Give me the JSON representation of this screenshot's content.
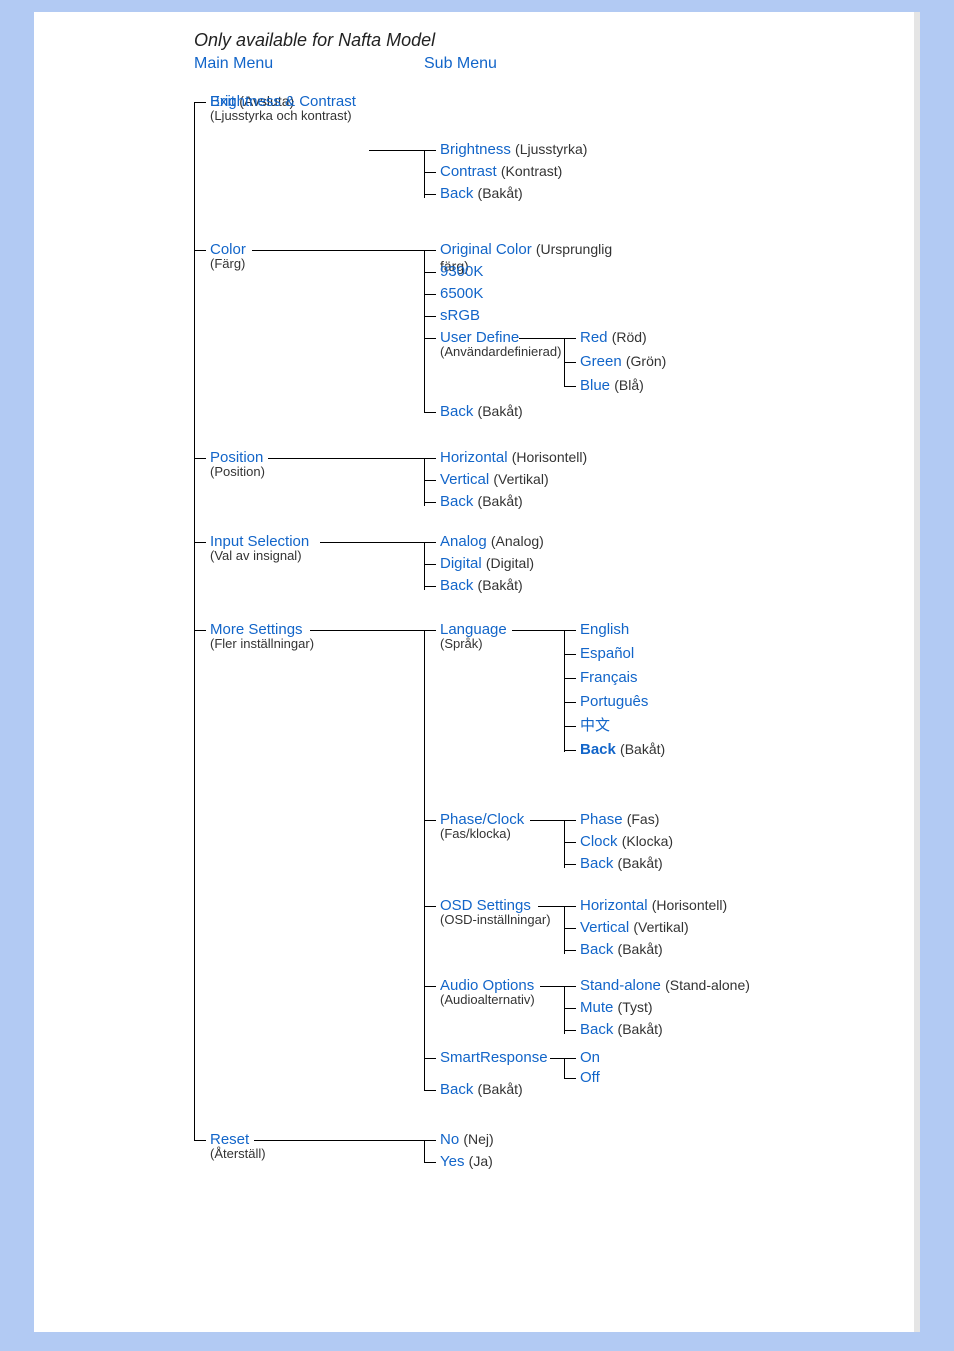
{
  "title": "Only available for Nafta Model",
  "headers": {
    "main": "Main Menu",
    "sub": "Sub Menu"
  },
  "exit": {
    "en": "Exit",
    "tr": "(Avsluta)"
  },
  "bc": {
    "en": "Brightness &  Contrast",
    "tr": "(Ljusstyrka och kontrast)",
    "brightness": {
      "en": "Brightness",
      "tr": "(Ljusstyrka)"
    },
    "contrast": {
      "en": "Contrast",
      "tr": "(Kontrast)"
    },
    "back": {
      "en": "Back",
      "tr": "(Bakåt)"
    }
  },
  "color": {
    "en": "Color",
    "tr": "(Färg)",
    "original": {
      "en": "Original Color",
      "tr": "(Ursprunglig färg)"
    },
    "k9300": "9300K",
    "k6500": "6500K",
    "srgb": "sRGB",
    "userdef": {
      "en": "User Define",
      "tr": "(Användardefinierad)"
    },
    "red": {
      "en": "Red",
      "tr": "(Röd)"
    },
    "green": {
      "en": "Green",
      "tr": "(Grön)"
    },
    "blue": {
      "en": "Blue",
      "tr": "(Blå)"
    },
    "back": {
      "en": "Back",
      "tr": "(Bakåt)"
    }
  },
  "position": {
    "en": "Position",
    "tr": "(Position)",
    "horizontal": {
      "en": "Horizontal",
      "tr": "(Horisontell)"
    },
    "vertical": {
      "en": "Vertical",
      "tr": "(Vertikal)"
    },
    "back": {
      "en": "Back",
      "tr": "(Bakåt)"
    }
  },
  "input": {
    "en": "Input Selection",
    "tr": "(Val av insignal)",
    "analog": {
      "en": "Analog",
      "tr": "(Analog)"
    },
    "digital": {
      "en": "Digital",
      "tr": "(Digital)"
    },
    "back": {
      "en": "Back",
      "tr": "(Bakåt)"
    }
  },
  "more": {
    "en": "More Settings",
    "tr": "(Fler inställningar)",
    "language": {
      "en": "Language",
      "tr": "(Språk)",
      "english": "English",
      "espanol": "Español",
      "francais": "Français",
      "portugues": "Português",
      "chinese": "中文",
      "back": {
        "en": "Back",
        "tr": "(Bakåt)"
      }
    },
    "phaseclock": {
      "en": "Phase/Clock",
      "tr": "(Fas/klocka)",
      "phase": {
        "en": "Phase",
        "tr": "(Fas)"
      },
      "clock": {
        "en": "Clock",
        "tr": "(Klocka)"
      },
      "back": {
        "en": "Back",
        "tr": "(Bakåt)"
      }
    },
    "osd": {
      "en": "OSD Settings",
      "tr": "(OSD-inställningar)",
      "horizontal": {
        "en": "Horizontal",
        "tr": "(Horisontell)"
      },
      "vertical": {
        "en": "Vertical",
        "tr": "(Vertikal)"
      },
      "back": {
        "en": "Back",
        "tr": "(Bakåt)"
      }
    },
    "audio": {
      "en": "Audio Options",
      "tr": "(Audioalternativ)",
      "standalone": {
        "en": "Stand-alone",
        "tr": "(Stand-alone)"
      },
      "mute": {
        "en": "Mute",
        "tr": "(Tyst)"
      },
      "back": {
        "en": "Back",
        "tr": "(Bakåt)"
      }
    },
    "smartresponse": {
      "en": "SmartResponse",
      "on": "On",
      "off": "Off"
    },
    "back": {
      "en": "Back",
      "tr": "(Bakåt)"
    }
  },
  "reset": {
    "en": "Reset",
    "tr": "(Återställ)",
    "no": {
      "en": "No",
      "tr": "(Nej)"
    },
    "yes": {
      "en": "Yes",
      "tr": "(Ja)"
    }
  }
}
